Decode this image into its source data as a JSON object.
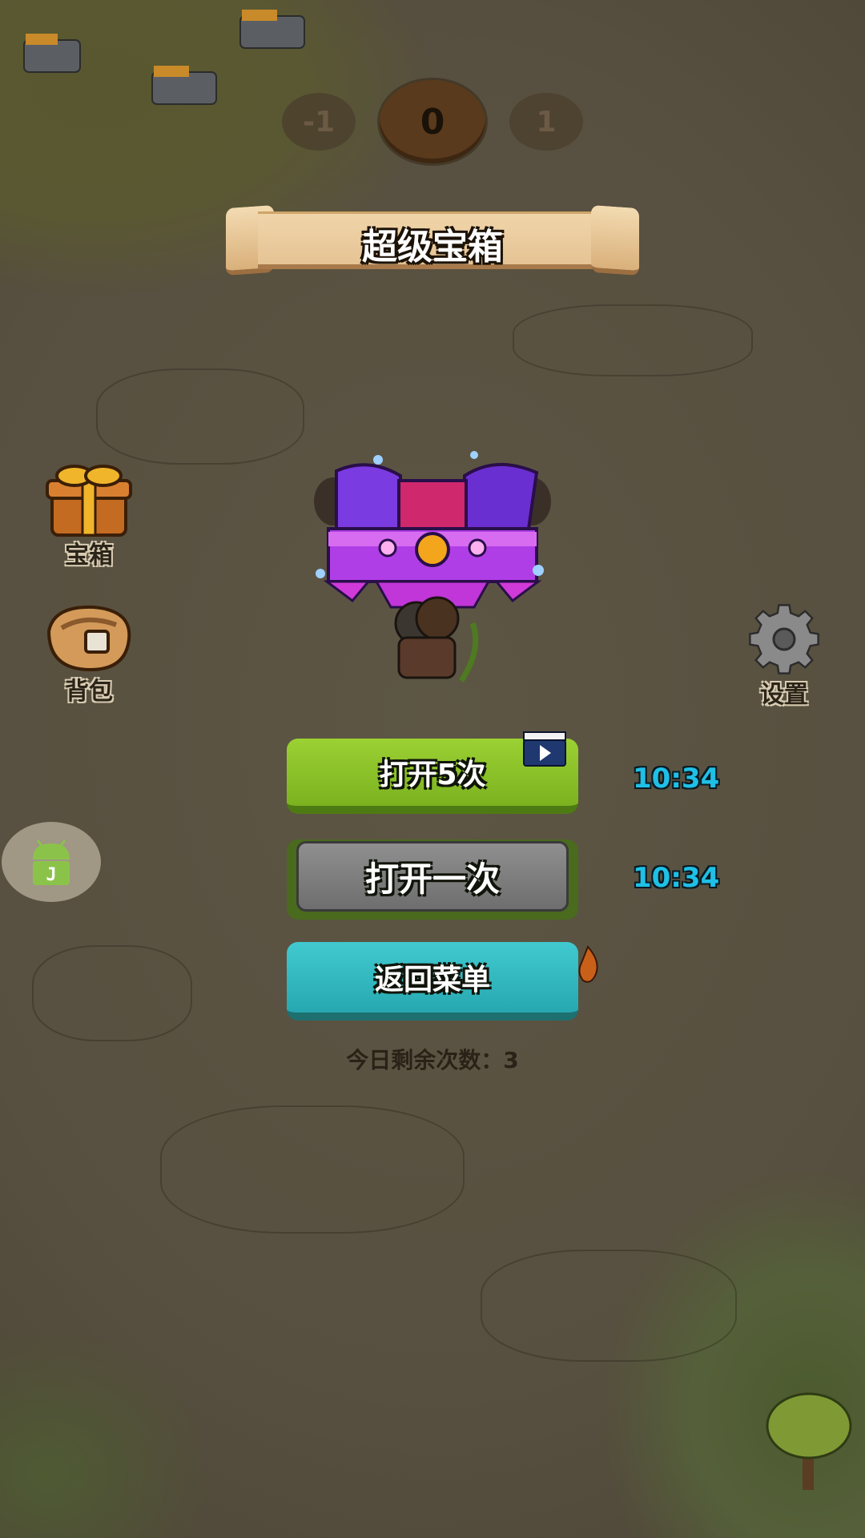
{
  "level_selector": {
    "prev": "-1",
    "current": "0",
    "next": "1"
  },
  "banner": {
    "title": "超级宝箱"
  },
  "side_menu": {
    "chest_label": "宝箱",
    "bag_label": "背包",
    "settings_label": "设置"
  },
  "actions": {
    "open_five_label": "打开5次",
    "open_five_timer": "10:34",
    "open_once_label": "打开一次",
    "open_once_timer": "10:34",
    "back_label": "返回菜单"
  },
  "remaining_text": "今日剩余次数：3",
  "colors": {
    "green_button": "#8cc22a",
    "gray_button": "#7f7f7f",
    "teal_button": "#33b8bf",
    "timer": "#1fc0e6",
    "chest_purple": "#b03ee6"
  },
  "icons": [
    "gift-box-icon",
    "backpack-icon",
    "gear-icon",
    "video-ad-icon",
    "android-icon",
    "treasure-chest-icon"
  ]
}
